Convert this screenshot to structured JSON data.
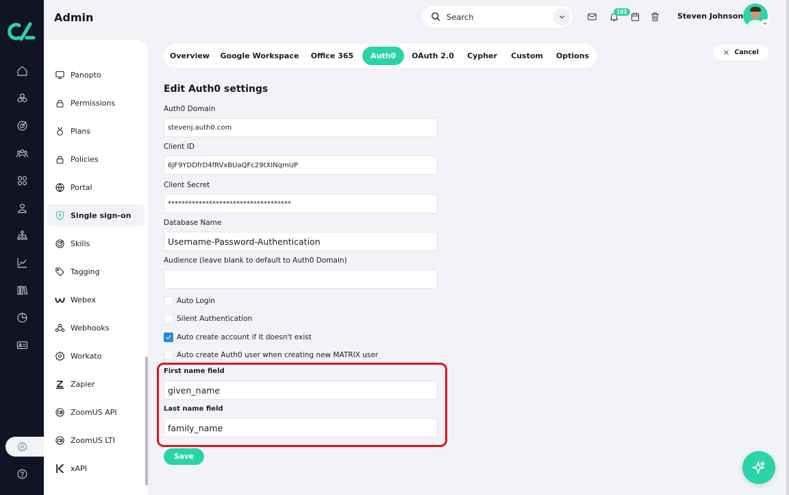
{
  "header": {
    "app_title": "Admin",
    "search_placeholder": "Search",
    "notification_count": "102",
    "user_name": "Steven Johnson"
  },
  "sidebar": {
    "items": [
      {
        "label": "Panopto",
        "icon": "monitor-icon"
      },
      {
        "label": "Permissions",
        "icon": "lock-icon"
      },
      {
        "label": "Plans",
        "icon": "medal-icon"
      },
      {
        "label": "Policies",
        "icon": "lock-icon"
      },
      {
        "label": "Portal",
        "icon": "globe-icon"
      },
      {
        "label": "Single sign-on",
        "icon": "shield-icon"
      },
      {
        "label": "Skills",
        "icon": "skills-icon"
      },
      {
        "label": "Tagging",
        "icon": "tag-icon"
      },
      {
        "label": "Webex",
        "icon": "webex-icon"
      },
      {
        "label": "Webhooks",
        "icon": "webhook-icon"
      },
      {
        "label": "Workato",
        "icon": "gear-icon"
      },
      {
        "label": "Zapier",
        "icon": "zapier-icon"
      },
      {
        "label": "ZoomUS API",
        "icon": "video-icon"
      },
      {
        "label": "ZoomUS LTI",
        "icon": "video-icon"
      },
      {
        "label": "xAPI",
        "icon": "xapi-icon"
      }
    ],
    "active": "Single sign-on"
  },
  "tabs": [
    {
      "label": "Overview"
    },
    {
      "label": "Google Workspace"
    },
    {
      "label": "Office 365"
    },
    {
      "label": "Auth0",
      "active": true
    },
    {
      "label": "OAuth 2.0"
    },
    {
      "label": "Cypher"
    },
    {
      "label": "Custom"
    },
    {
      "label": "Options"
    }
  ],
  "cancel_label": "Cancel",
  "form": {
    "title": "Edit Auth0 settings",
    "domain": {
      "label": "Auth0 Domain",
      "value": "stevenj.auth0.com"
    },
    "client_id": {
      "label": "Client ID",
      "value": "6JF9YDDfrD4fRVxBUaQFc29tXINqmUP"
    },
    "client_secret": {
      "label": "Client Secret",
      "value": "************************************"
    },
    "database": {
      "label": "Database Name",
      "value": "Username-Password-Authentication"
    },
    "audience": {
      "label": "Audience (leave blank to default to Auth0 Domain)",
      "value": ""
    },
    "checkboxes": [
      {
        "label": "Auto Login",
        "checked": false
      },
      {
        "label": "Silent Authentication",
        "checked": false
      },
      {
        "label": "Auto create account if it doesn't exist",
        "checked": true
      },
      {
        "label": "Auto create Auth0 user when creating new MATRIX user",
        "checked": false
      }
    ],
    "first_name": {
      "label": "First name field",
      "value": "given_name"
    },
    "last_name": {
      "label": "Last name field",
      "value": "family_name"
    },
    "save_label": "Save"
  },
  "colors": {
    "accent": "#2bd4a6",
    "rail": "#101424",
    "highlight": "#e0141c",
    "checkbox": "#2b88d8"
  }
}
